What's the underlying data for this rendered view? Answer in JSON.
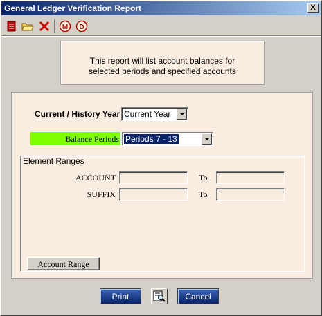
{
  "window": {
    "title": "General Ledger Verification Report",
    "close_label": "X"
  },
  "toolbar": {
    "buttons": [
      {
        "icon": "report-icon"
      },
      {
        "icon": "open-folder-icon"
      },
      {
        "icon": "delete-icon"
      },
      {
        "icon": "m-icon",
        "label": "M"
      },
      {
        "icon": "d-icon",
        "label": "D"
      }
    ]
  },
  "info": {
    "line1": "This report will list account balances for",
    "line2": "selected periods and specified accounts"
  },
  "form": {
    "year_label": "Current / History Year",
    "year_value": "Current Year",
    "periods_label": "Balance Periods",
    "periods_value": "Periods 7 - 13"
  },
  "ranges": {
    "title": "Element Ranges",
    "rows": [
      {
        "label": "ACCOUNT",
        "to": "To"
      },
      {
        "label": "SUFFIX",
        "to": "To"
      }
    ],
    "account_range_button": "Account Range"
  },
  "actions": {
    "print": "Print",
    "cancel": "Cancel"
  },
  "colors": {
    "title_start": "#0a246a",
    "title_end": "#a6caf0",
    "panel_bg": "#f8ede0",
    "periods_highlight": "#80ff00",
    "selection": "#0a246a"
  }
}
